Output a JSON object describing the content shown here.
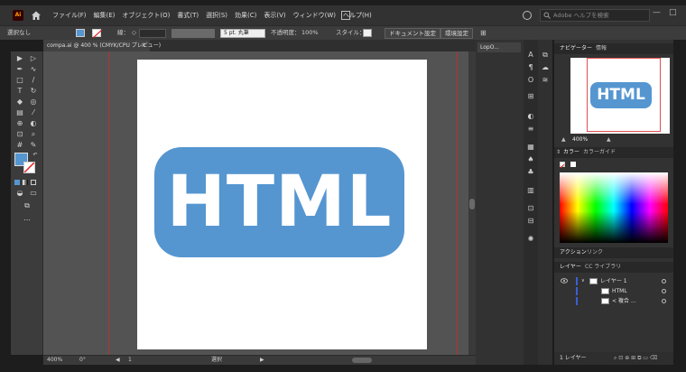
{
  "app": {
    "logo_text": "Ai",
    "menu": [
      "ファイル(F)",
      "編集(E)",
      "オブジェクト(O)",
      "書式(T)",
      "選択(S)",
      "効果(C)",
      "表示(V)",
      "ウィンドウ(W)",
      "ヘルプ(H)"
    ],
    "search_placeholder": "Adobe ヘルプを検索",
    "win_min": "—",
    "win_max": "□"
  },
  "control_bar": {
    "selection": "選択なし",
    "stroke_label": "線：",
    "stroke_value": "◇",
    "brush": "5 pt. 丸筆",
    "opacity_label": "不透明度：",
    "opacity_value": "100%",
    "style_label": "スタイル：",
    "doc_settings_button": "ドキュメント設定",
    "prefs_button": "環境設定",
    "fill_color": "#5596d0"
  },
  "document": {
    "tab_title": "compa.ai @ 400 % (CMYK/CPU プレビュー)",
    "tab_close": "×",
    "artwork_text": "HTML",
    "artwork_color": "#5596d0"
  },
  "status_bar": {
    "zoom": "400%",
    "rotation": "0°",
    "page": "1",
    "tool": "選択"
  },
  "panels": {
    "lopo_tab": "LopO...",
    "navigator_tab": "ナビゲーター",
    "info_tab": "情報",
    "navigator_zoom": "400%",
    "color_tab": "カラー",
    "color_guide_tab": "カラーガイド",
    "actions_tab": "アクション",
    "links_tab": "リンク",
    "layers_tab": "レイヤー",
    "libraries_tab": "CC ライブラリ",
    "layers": [
      {
        "name": "レイヤー 1"
      },
      {
        "name": "HTML"
      },
      {
        "name": "< 複合 ..."
      }
    ],
    "layer_count": "1 レイヤー"
  }
}
